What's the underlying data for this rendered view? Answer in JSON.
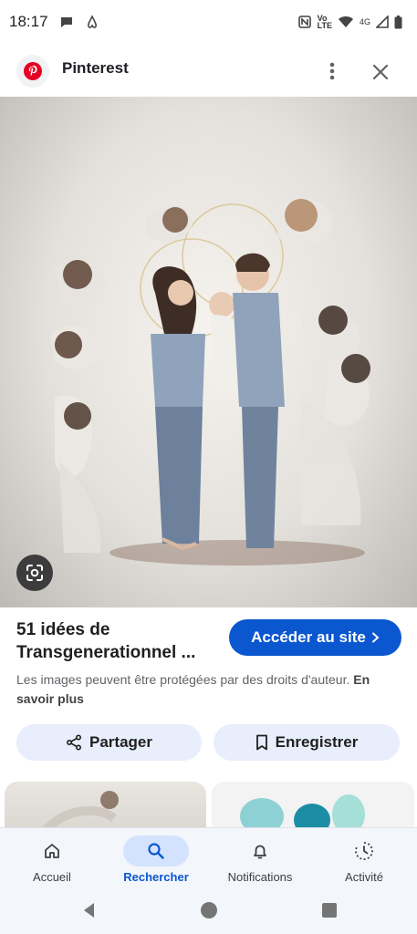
{
  "status_bar": {
    "time": "18:17",
    "network": "4G",
    "volte": "Vo\nLTE"
  },
  "app_bar": {
    "title": "Pinterest",
    "more_icon": "more-vert-icon",
    "close_icon": "close-icon"
  },
  "result": {
    "title": "51 idées de Transgenerationnel ...",
    "visit_label": "Accéder au site",
    "copyright_text": "Les images peuvent être protégées par des droits d'auteur.",
    "learn_more": "En savoir plus"
  },
  "actions": {
    "share_label": "Partager",
    "save_label": "Enregistrer"
  },
  "bottom_nav": {
    "items": [
      {
        "label": "Accueil",
        "icon": "home-icon"
      },
      {
        "label": "Rechercher",
        "icon": "search-icon",
        "active": true
      },
      {
        "label": "Notifications",
        "icon": "bell-icon"
      },
      {
        "label": "Activité",
        "icon": "activity-icon"
      }
    ]
  },
  "colors": {
    "accent": "#0b57d0",
    "pinterest": "#e60023",
    "chip_bg": "#e8eefb",
    "active_nav_bg": "#d3e3fd"
  }
}
